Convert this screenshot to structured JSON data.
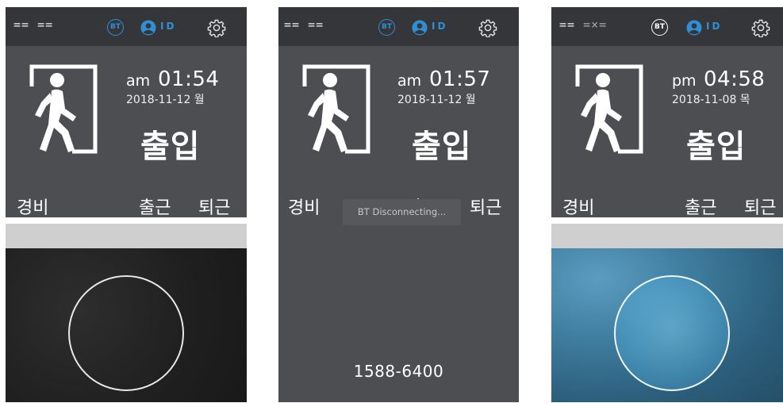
{
  "screens": [
    {
      "status": {
        "conn_left": "==",
        "conn_right": "==",
        "bt_label": "BT",
        "id_label": "ID"
      },
      "clock": {
        "ampm": "am",
        "time": "01:54",
        "date": "2018-11-12 월"
      },
      "mode_label": "출입",
      "buttons": {
        "guard": "경비",
        "clock_in": "출근",
        "clock_out": "퇴근"
      }
    },
    {
      "status": {
        "conn_left": "==",
        "conn_right": "==",
        "bt_label": "BT",
        "id_label": "ID"
      },
      "clock": {
        "ampm": "am",
        "time": "01:57",
        "date": "2018-11-12 월"
      },
      "mode_label": "출입",
      "buttons": {
        "guard": "경비",
        "clock_in": "출근",
        "clock_out": "퇴근"
      },
      "toast": "BT Disconnecting...",
      "phone": "1588-6400"
    },
    {
      "status": {
        "conn_left": "==",
        "conn_right": "=×=",
        "bt_label": "BT",
        "id_label": "ID"
      },
      "clock": {
        "ampm": "pm",
        "time": "04:58",
        "date": "2018-11-08 목"
      },
      "mode_label": "출입",
      "buttons": {
        "guard": "경비",
        "clock_in": "출근",
        "clock_out": "퇴근"
      }
    }
  ],
  "colors": {
    "status_bar": "#35363a",
    "panel": "#4d4e52",
    "accent_blue": "#2f8fd6"
  },
  "icons": [
    "connection-icon",
    "bluetooth-icon",
    "id-icon",
    "gear-icon",
    "exit-person-icon",
    "camera-face-circle"
  ]
}
